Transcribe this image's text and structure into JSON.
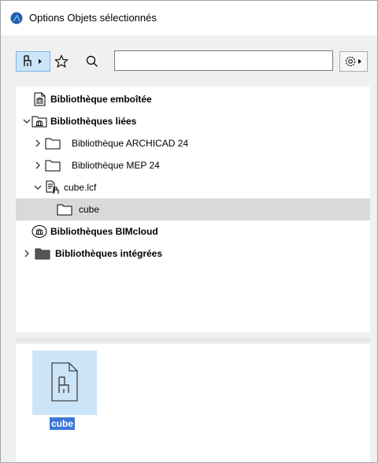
{
  "window": {
    "title": "Options Objets sélectionnés"
  },
  "toolbar": {
    "library_icon": "library-chair-icon",
    "favorites_icon": "star-icon",
    "search_icon": "search-icon",
    "search_value": "",
    "settings_icon": "gear-icon"
  },
  "tree": {
    "items": [
      {
        "label": "Bibliothèque emboîtée",
        "icon": "embedded-library-icon",
        "bold": true,
        "level": 0,
        "expander": "none"
      },
      {
        "label": "Bibliothèques liées",
        "icon": "linked-libraries-icon",
        "bold": true,
        "level": 0,
        "expander": "expanded"
      },
      {
        "label": "Bibliothèque ARCHICAD 24",
        "icon": "folder-icon",
        "bold": false,
        "level": 1,
        "expander": "collapsed"
      },
      {
        "label": "Bibliothèque MEP 24",
        "icon": "folder-icon",
        "bold": false,
        "level": 1,
        "expander": "collapsed"
      },
      {
        "label": "cube.lcf",
        "icon": "lcf-container-icon",
        "bold": false,
        "level": 1,
        "expander": "expanded"
      },
      {
        "label": "cube",
        "icon": "folder-icon",
        "bold": false,
        "level": 2,
        "expander": "none",
        "selected": true
      },
      {
        "label": "Bibliothèques BIMcloud",
        "icon": "bimcloud-library-icon",
        "bold": true,
        "level": 0,
        "expander": "none"
      },
      {
        "label": "Bibliothèques intégrées",
        "icon": "builtin-folder-icon",
        "bold": true,
        "level": 0,
        "expander": "collapsed"
      }
    ]
  },
  "preview": {
    "items": [
      {
        "label": "cube",
        "icon": "object-file-icon",
        "selected": true
      }
    ]
  },
  "colors": {
    "accent": "#3b78d8",
    "selection_row": "#d9d9d9",
    "tile_highlight": "#cce4f7"
  }
}
